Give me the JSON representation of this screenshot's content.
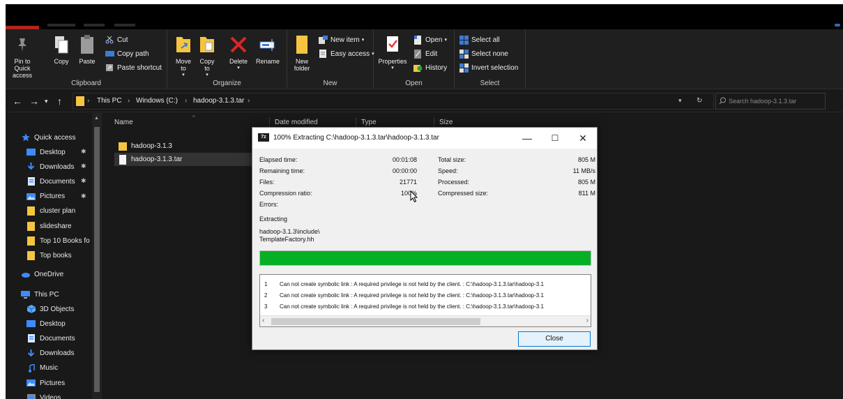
{
  "colors": {
    "accent": "#0078d7",
    "progress": "#06b025",
    "folder": "#f5c542",
    "dark_bg": "#191919"
  },
  "ribbon": {
    "clipboard": {
      "label": "Clipboard",
      "pin": "Pin to Quick access",
      "copy": "Copy",
      "paste": "Paste",
      "cut": "Cut",
      "copy_path": "Copy path",
      "paste_shortcut": "Paste shortcut"
    },
    "organize": {
      "label": "Organize",
      "move_to": "Move to",
      "copy_to": "Copy to",
      "delete": "Delete",
      "rename": "Rename"
    },
    "new": {
      "label": "New",
      "new_folder": "New folder",
      "new_item": "New item",
      "easy_access": "Easy access"
    },
    "open": {
      "label": "Open",
      "properties": "Properties",
      "open": "Open",
      "edit": "Edit",
      "history": "History"
    },
    "select": {
      "label": "Select",
      "select_all": "Select all",
      "select_none": "Select none",
      "invert": "Invert selection"
    }
  },
  "address": {
    "crumbs": [
      "This PC",
      "Windows (C:)",
      "hadoop-3.1.3.tar"
    ],
    "search_placeholder": "Search hadoop-3.1.3.tar"
  },
  "navpane": {
    "quick_access": "Quick access",
    "quick_items": [
      {
        "label": "Desktop",
        "icon": "desktop-icon"
      },
      {
        "label": "Downloads",
        "icon": "download-icon"
      },
      {
        "label": "Documents",
        "icon": "document-icon"
      },
      {
        "label": "Pictures",
        "icon": "pictures-icon"
      },
      {
        "label": "cluster plan",
        "icon": "folder-icon"
      },
      {
        "label": "slideshare",
        "icon": "folder-icon"
      },
      {
        "label": "Top 10 Books fo",
        "icon": "folder-icon"
      },
      {
        "label": "Top books",
        "icon": "folder-icon"
      }
    ],
    "onedrive": "OneDrive",
    "this_pc": "This PC",
    "pc_items": [
      {
        "label": "3D Objects",
        "icon": "cube-icon"
      },
      {
        "label": "Desktop",
        "icon": "desktop-icon"
      },
      {
        "label": "Documents",
        "icon": "document-icon"
      },
      {
        "label": "Downloads",
        "icon": "download-icon"
      },
      {
        "label": "Music",
        "icon": "music-icon"
      },
      {
        "label": "Pictures",
        "icon": "pictures-icon"
      },
      {
        "label": "Videos",
        "icon": "video-icon"
      }
    ]
  },
  "filelist": {
    "columns": [
      "Name",
      "Date modified",
      "Type",
      "Size"
    ],
    "rows": [
      {
        "name": "hadoop-3.1.3",
        "icon": "folder-icon"
      },
      {
        "name": "hadoop-3.1.3.tar",
        "icon": "file-icon"
      }
    ]
  },
  "dialog": {
    "logo": "7z",
    "title": "100% Extracting C:\\hadoop-3.1.3.tar\\hadoop-3.1.3.tar",
    "left_stats": [
      {
        "label": "Elapsed time:",
        "value": "00:01:08"
      },
      {
        "label": "Remaining time:",
        "value": "00:00:00"
      },
      {
        "label": "Files:",
        "value": "21771"
      },
      {
        "label": "Compression ratio:",
        "value": "100%"
      },
      {
        "label": "Errors:",
        "value": ""
      }
    ],
    "right_stats": [
      {
        "label": "Total size:",
        "value": "805 M"
      },
      {
        "label": "Speed:",
        "value": "11 MB/s"
      },
      {
        "label": "Processed:",
        "value": "805 M"
      },
      {
        "label": "Compressed size:",
        "value": "811 M"
      }
    ],
    "extracting_label": "Extracting",
    "current_path": "hadoop-3.1.3\\include\\",
    "current_file": "TemplateFactory.hh",
    "progress": 1.0,
    "log": [
      {
        "num": "1",
        "text": "Can not create symbolic link : A required privilege is not held by the client. : C:\\hadoop-3.1.3.tar\\hadoop-3.1"
      },
      {
        "num": "2",
        "text": "Can not create symbolic link : A required privilege is not held by the client. : C:\\hadoop-3.1.3.tar\\hadoop-3.1"
      },
      {
        "num": "3",
        "text": "Can not create symbolic link : A required privilege is not held by the client. : C:\\hadoop-3.1.3.tar\\hadoop-3.1"
      }
    ],
    "close_label": "Close"
  }
}
